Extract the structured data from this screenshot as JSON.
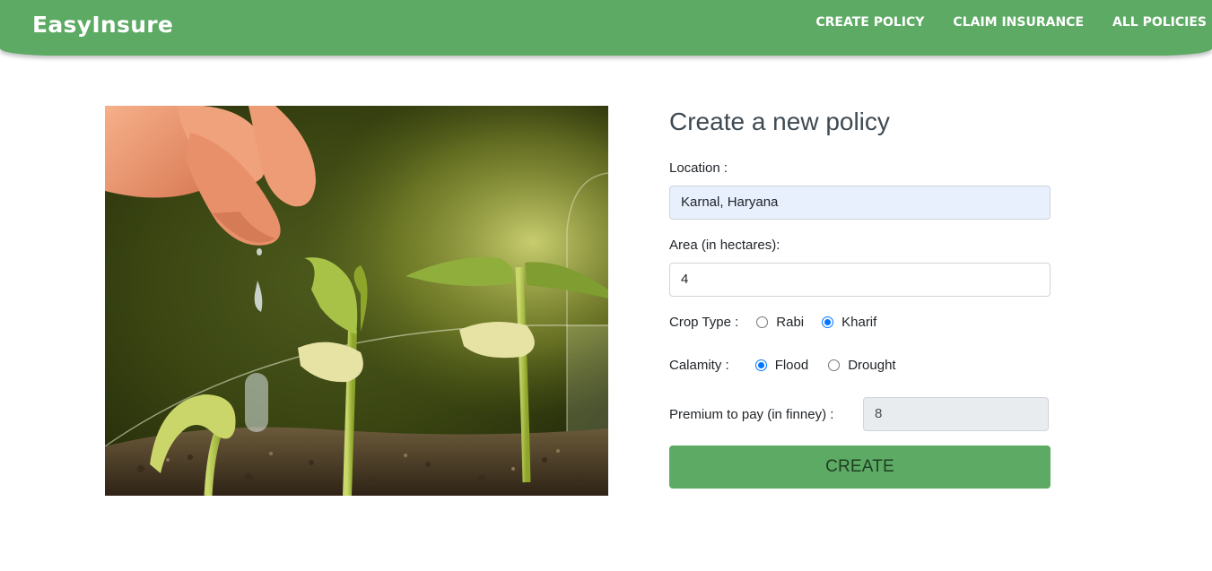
{
  "header": {
    "brand": "EasyInsure",
    "nav": [
      "CREATE POLICY",
      "CLAIM INSURANCE",
      "ALL POLICIES"
    ],
    "bg_color": "#5caa63"
  },
  "form": {
    "title": "Create a new policy",
    "location_label": "Location :",
    "location_value": "Karnal, Haryana",
    "area_label": "Area (in hectares):",
    "area_value": "4",
    "crop_label": "Crop Type :",
    "crop_options": [
      {
        "label": "Rabi",
        "checked": false
      },
      {
        "label": "Kharif",
        "checked": true
      }
    ],
    "calamity_label": "Calamity :",
    "calamity_options": [
      {
        "label": "Flood",
        "checked": true
      },
      {
        "label": "Drought",
        "checked": false
      }
    ],
    "premium_label": "Premium to pay (in finney) :",
    "premium_value": "8",
    "submit_label": "CREATE",
    "accent_color": "#0075ff"
  },
  "hero_image": {
    "subject": "hand-watering-seedlings-image"
  }
}
